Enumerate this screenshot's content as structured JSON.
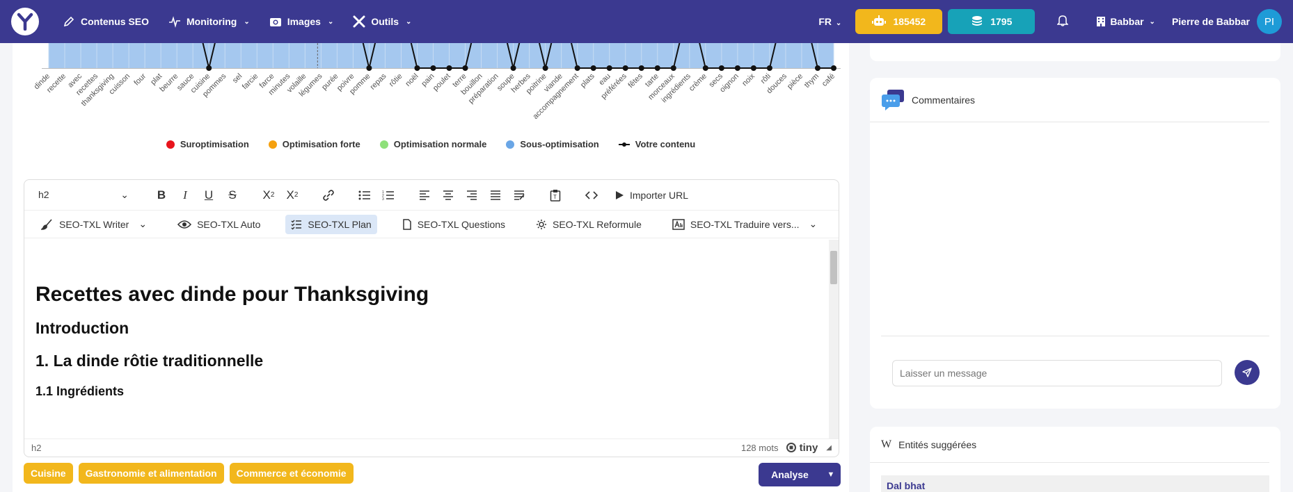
{
  "nav": {
    "items": [
      {
        "label": "Contenus SEO",
        "icon": "pencil-icon",
        "has_chevron": false
      },
      {
        "label": "Monitoring",
        "icon": "activity-icon",
        "has_chevron": true
      },
      {
        "label": "Images",
        "icon": "camera-icon",
        "has_chevron": true
      },
      {
        "label": "Outils",
        "icon": "tools-icon",
        "has_chevron": true
      }
    ],
    "lang": "FR",
    "credits_robot": "185452",
    "credits_coins": "1795",
    "org": "Babbar",
    "user": "Pierre de Babbar",
    "avatar_initials": "PI",
    "colors": {
      "bar": "#3b3990",
      "yellow": "#f2b71c",
      "teal": "#17a2b8",
      "avatar": "#1e9bd7"
    }
  },
  "chart_data": {
    "type": "area",
    "categories": [
      "dinde",
      "recette",
      "avec",
      "recettes",
      "thanksgiving",
      "cuisson",
      "four",
      "plat",
      "beurre",
      "sauce",
      "cuisine",
      "pommes",
      "sel",
      "farcie",
      "farce",
      "minutes",
      "volaille",
      "légumes",
      "purée",
      "poivre",
      "pomme",
      "repas",
      "rôtie",
      "noël",
      "pain",
      "poulet",
      "terre",
      "bouillon",
      "préparation",
      "soupe",
      "herbes",
      "poitrine",
      "viande",
      "accompagnement",
      "plats",
      "eau",
      "préférées",
      "fêtes",
      "tarte",
      "morceaux",
      "ingrédients",
      "crème",
      "secs",
      "oignon",
      "noix",
      "rôti",
      "douces",
      "pièce",
      "thym",
      "café"
    ],
    "series": [
      {
        "name": "Votre contenu",
        "values": [
          1,
          1,
          1,
          1,
          1,
          1,
          1,
          1,
          1,
          1,
          0,
          1,
          1,
          1,
          1,
          1,
          1,
          1,
          1,
          1,
          0,
          1,
          1,
          0,
          0,
          0,
          0,
          1,
          1,
          0,
          1,
          0,
          1,
          0,
          0,
          0,
          0,
          0,
          0,
          0,
          1,
          0,
          0,
          0,
          0,
          0,
          1,
          1,
          0,
          0
        ]
      }
    ],
    "legend": [
      "Suroptimisation",
      "Optimisation forte",
      "Optimisation normale",
      "Sous-optimisation",
      "Votre contenu"
    ],
    "legend_colors": [
      "#e8141c",
      "#f5a10f",
      "#8ee07a",
      "#6aa6e6",
      "#111111"
    ],
    "legend_placement": "bottom",
    "fill_color": "#a5c8ef"
  },
  "editor": {
    "block_format": "h2",
    "import_url_label": "Importer URL",
    "tools": [
      {
        "label": "SEO-TXL Writer",
        "icon": "brush-icon",
        "active": false,
        "chevron": true
      },
      {
        "label": "SEO-TXL Auto",
        "icon": "eye-icon",
        "active": false,
        "chevron": false
      },
      {
        "label": "SEO-TXL Plan",
        "icon": "checklist-icon",
        "active": true,
        "chevron": false
      },
      {
        "label": "SEO-TXL Questions",
        "icon": "document-icon",
        "active": false,
        "chevron": false
      },
      {
        "label": "SEO-TXL Reformule",
        "icon": "gear-icon",
        "active": false,
        "chevron": false
      },
      {
        "label": "SEO-TXL Traduire vers...",
        "icon": "translate-icon",
        "active": false,
        "chevron": true
      }
    ],
    "content": {
      "h1": "Recettes avec dinde pour Thanksgiving",
      "h2_intro": "Introduction",
      "h2_section1": "1. La dinde rôtie traditionnelle",
      "h3_sub1": "1.1 Ingrédients"
    },
    "status_path": "h2",
    "word_count": "128 mots",
    "brand": "tiny"
  },
  "tags": [
    "Cuisine",
    "Gastronomie et alimentation",
    "Commerce et économie"
  ],
  "analyse_label": "Analyse",
  "comments": {
    "title": "Commentaires",
    "placeholder": "Laisser un message"
  },
  "entities": {
    "title": "Entités suggérées",
    "first": "Dal bhat"
  }
}
